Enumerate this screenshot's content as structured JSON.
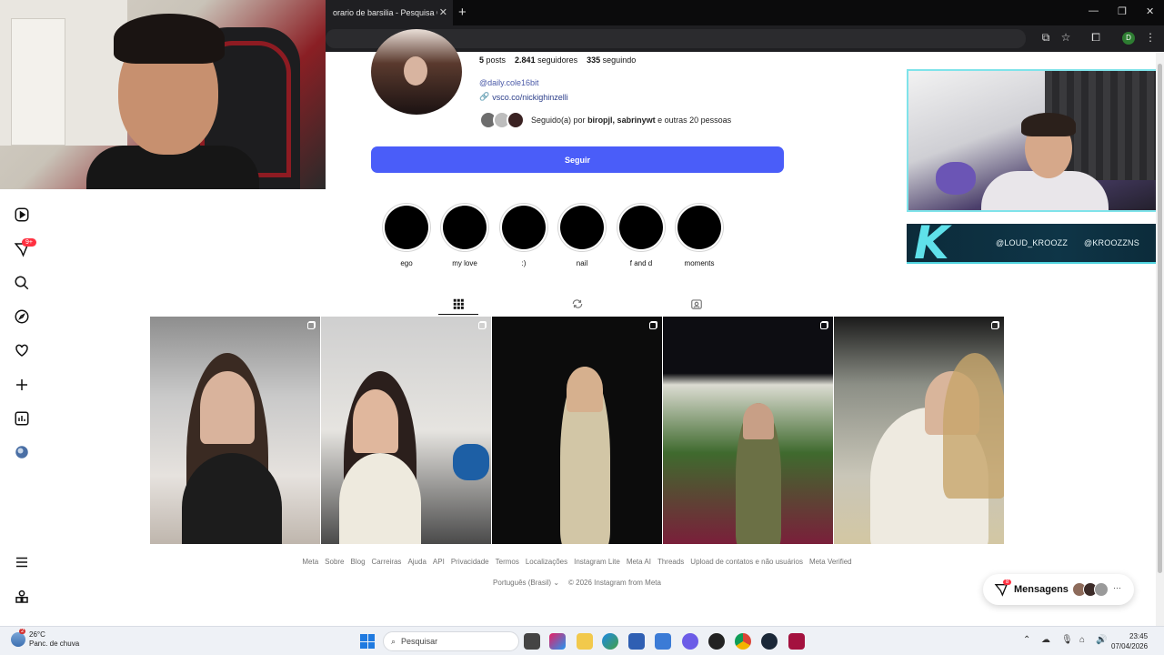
{
  "browser": {
    "tab_title": "orario de barsilia - Pesquisa Go",
    "tab_close": "✕",
    "new_tab": "+",
    "profile_initial": "D"
  },
  "overlay": {
    "handle_left": "@LOUD_KROOZZ",
    "handle_right": "@KROOZZNS",
    "logo_letter": "K"
  },
  "nav": {
    "notifications_badge": "9+"
  },
  "profile": {
    "posts_count": "5",
    "posts_label": "posts",
    "followers_count": "2.841",
    "followers_label": "seguidores",
    "following_count": "335",
    "following_label": "seguindo",
    "threads_handle": "@daily.cole16bit",
    "link": "vsco.co/nickighinzelli",
    "followed_by_prefix": "Seguido(a) por",
    "followed_by_names": "biropjl, sabrinywt",
    "followed_by_suffix": "e outras 20 pessoas",
    "follow_button": "Seguir"
  },
  "highlights": [
    {
      "label": "ego"
    },
    {
      "label": "my love"
    },
    {
      "label": ":)"
    },
    {
      "label": "nail"
    },
    {
      "label": "f and d"
    },
    {
      "label": "moments"
    }
  ],
  "footer": {
    "links": [
      "Meta",
      "Sobre",
      "Blog",
      "Carreiras",
      "Ajuda",
      "API",
      "Privacidade",
      "Termos",
      "Localizações",
      "Instagram Lite",
      "Meta AI",
      "Threads",
      "Upload de contatos e não usuários",
      "Meta Verified"
    ],
    "language": "Português (Brasil)",
    "copyright": "© 2026 Instagram from Meta"
  },
  "messages": {
    "label": "Mensagens",
    "badge": "8",
    "more": "···"
  },
  "taskbar": {
    "temperature": "26°C",
    "weather_desc": "Panc. de chuva",
    "weather_badge": "2",
    "search_placeholder": "Pesquisar",
    "time": "23:45",
    "date": "07/04/2026"
  },
  "colors": {
    "follow_button": "#4a5df9",
    "badge_red": "#ff3040",
    "overlay_accent": "#5fe1ea"
  }
}
